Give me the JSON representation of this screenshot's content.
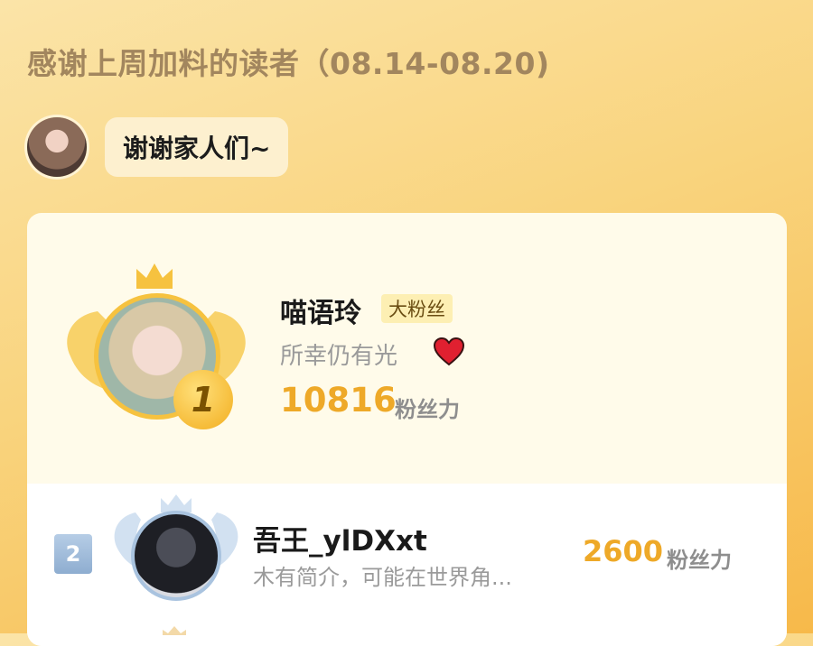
{
  "header": {
    "title": "感谢上周加料的读者（08.14-08.20)"
  },
  "greeting": {
    "message": "谢谢家人们~"
  },
  "leaderboard": {
    "first": {
      "rank": "1",
      "name": "喵语玲",
      "badge": "大粉丝",
      "bio": "所幸仍有光",
      "fan_power": "10816",
      "fan_power_unit": "粉丝力"
    },
    "second": {
      "rank": "2",
      "name": "吾王_ylDXxt",
      "bio": "木有简介，可能在世界角...",
      "fan_power": "2600",
      "fan_power_unit": "粉丝力"
    }
  },
  "colors": {
    "gold": "#eea928",
    "rank1_ring": "#f6c23f",
    "rank2_ring": "#a9c3df",
    "heart": "#e02030"
  },
  "icons": [
    "crown-icon",
    "wing-icon",
    "heart-icon"
  ]
}
